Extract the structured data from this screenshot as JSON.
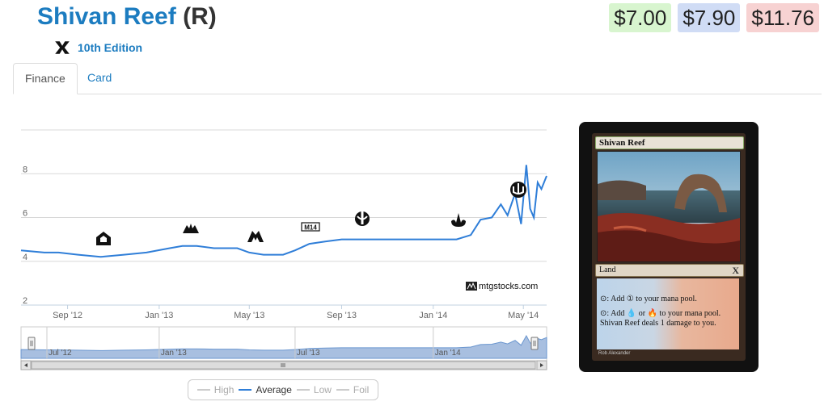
{
  "header": {
    "card_name": "Shivan Reef",
    "rarity": "(R)",
    "set_icon": "tenth-edition-set-icon",
    "set_name": "10th Edition"
  },
  "prices": {
    "low": "$7.00",
    "avg": "$7.90",
    "high": "$11.76"
  },
  "tabs": [
    {
      "label": "Finance",
      "active": true
    },
    {
      "label": "Card",
      "active": false
    }
  ],
  "colors": {
    "link": "#1c7cc0",
    "series": "#2f7ed8",
    "low_bg": "#d8f5cf",
    "avg_bg": "#d0dcf5",
    "high_bg": "#f7d2d2"
  },
  "chart_data": {
    "type": "line",
    "x_axis_labels": [
      "Sep '12",
      "Jan '13",
      "May '13",
      "Sep '13",
      "Jan '14",
      "May '14"
    ],
    "y_axis_labels": [
      "2",
      "4",
      "6",
      "8"
    ],
    "ylim": [
      2,
      10
    ],
    "grid": true,
    "series": [
      {
        "name": "Average",
        "x": [
          "2012-07-01",
          "2012-08-01",
          "2012-08-20",
          "2012-09-15",
          "2012-10-15",
          "2012-11-15",
          "2012-12-15",
          "2013-01-15",
          "2013-02-01",
          "2013-02-20",
          "2013-03-15",
          "2013-04-15",
          "2013-05-01",
          "2013-05-20",
          "2013-06-15",
          "2013-07-01",
          "2013-07-20",
          "2013-08-10",
          "2013-09-01",
          "2013-10-01",
          "2013-11-01",
          "2013-12-01",
          "2014-01-01",
          "2014-02-01",
          "2014-02-20",
          "2014-03-05",
          "2014-03-20",
          "2014-04-01",
          "2014-04-10",
          "2014-04-20",
          "2014-04-28",
          "2014-05-05",
          "2014-05-10",
          "2014-05-15",
          "2014-05-20",
          "2014-05-25",
          "2014-06-01"
        ],
        "values": [
          4.5,
          4.4,
          4.4,
          4.3,
          4.2,
          4.3,
          4.4,
          4.6,
          4.7,
          4.7,
          4.6,
          4.6,
          4.4,
          4.3,
          4.3,
          4.5,
          4.8,
          4.9,
          5.0,
          5.0,
          5.0,
          5.0,
          5.0,
          5.0,
          5.2,
          5.9,
          6.0,
          6.6,
          6.1,
          7.1,
          5.7,
          8.4,
          6.4,
          6.0,
          7.6,
          7.3,
          7.9
        ]
      }
    ],
    "annotations": {
      "set_release_icons": [
        "return-to-ravnica-icon",
        "gatecrash-icon",
        "dragons-maze-icon",
        "m14-icon",
        "theros-icon",
        "born-of-the-gods-icon",
        "journey-into-nyx-icon"
      ],
      "watermark": "mtgstocks.com"
    },
    "navigator_labels": [
      "Jul '12",
      "Jan '13",
      "Jul '13",
      "Jan '14"
    ]
  },
  "legend": [
    {
      "label": "High",
      "active": false
    },
    {
      "label": "Average",
      "active": true
    },
    {
      "label": "Low",
      "active": false
    },
    {
      "label": "Foil",
      "active": false
    }
  ],
  "card_image": {
    "name": "Shivan Reef",
    "type": "Land",
    "set_symbol": "X",
    "text_line1": "⊙: Add ① to your mana pool.",
    "text_line2": "⊙: Add 💧 or 🔥 to your mana pool.",
    "text_line3": "Shivan Reef deals 1 damage to you.",
    "artist": "Rob Alexander"
  }
}
